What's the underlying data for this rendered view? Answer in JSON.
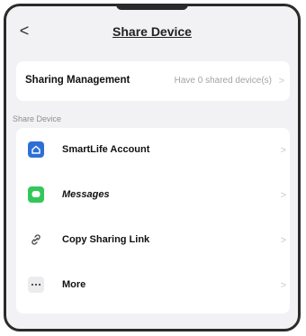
{
  "header": {
    "back_icon": "chevron-left-icon",
    "back_glyph": "<",
    "title": "Share Device"
  },
  "management": {
    "label": "Sharing Management",
    "value": "Have 0 shared device(s)",
    "chevron": ">"
  },
  "section": {
    "label": "Share Device"
  },
  "share_options": [
    {
      "label": "SmartLife  Account",
      "icon": "smartlife-home-icon",
      "chevron": ">"
    },
    {
      "label": "Messages",
      "icon": "messages-bubble-icon",
      "chevron": ">"
    },
    {
      "label": "Copy Sharing Link",
      "icon": "link-icon",
      "chevron": ">"
    },
    {
      "label": "More",
      "icon": "more-dots-icon",
      "chevron": ">"
    }
  ],
  "colors": {
    "smartlife_icon": "#2d6fd6",
    "messages_icon": "#33c759",
    "background": "#f2f2f4"
  }
}
